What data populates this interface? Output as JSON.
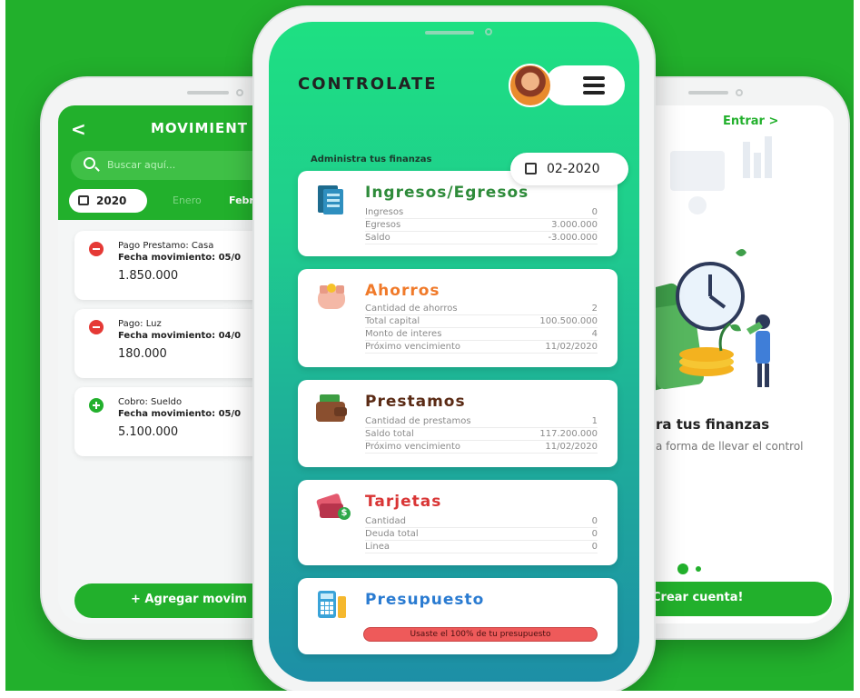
{
  "colors": {
    "brand_green": "#22b02c",
    "income_title": "#2e8b3a",
    "savings_title": "#f07a2a",
    "loans_title": "#5a2a14",
    "cards_title": "#d93535",
    "budget_title": "#2a7bd1"
  },
  "left_screen": {
    "title": "MOVIMIENT",
    "back_icon": "back-chevron-icon",
    "search_placeholder": "Buscar aquí...",
    "year": "2020",
    "months": [
      "Enero",
      "Febr"
    ],
    "movements": [
      {
        "title": "Pago Prestamo: Casa",
        "date": "Fecha movimiento: 05/0",
        "amount": "1.850.000",
        "type": "minus"
      },
      {
        "title": "Pago: Luz",
        "date": "Fecha movimiento: 04/0",
        "amount": "180.000",
        "type": "minus"
      },
      {
        "title": "Cobro: Sueldo",
        "date": "Fecha movimiento: 05/0",
        "amount": "5.100.000",
        "type": "plus"
      }
    ],
    "add_button": "+ Agregar movim"
  },
  "center_screen": {
    "brand": "CONTROLATE",
    "subtitle": "Administra tus finanzas",
    "date_filter": "02-2020",
    "cards": [
      {
        "title": "Ingresos/Egresos",
        "rows": [
          {
            "label": "Ingresos",
            "value": "0"
          },
          {
            "label": "Egresos",
            "value": "3.000.000"
          },
          {
            "label": "Saldo",
            "value": "-3.000.000"
          }
        ]
      },
      {
        "title": "Ahorros",
        "rows": [
          {
            "label": "Cantidad de ahorros",
            "value": "2"
          },
          {
            "label": "Total capital",
            "value": "100.500.000"
          },
          {
            "label": "Monto de interes",
            "value": "4"
          },
          {
            "label": "Próximo vencimiento",
            "value": "11/02/2020"
          }
        ]
      },
      {
        "title": "Prestamos",
        "rows": [
          {
            "label": "Cantidad de prestamos",
            "value": "1"
          },
          {
            "label": "Saldo total",
            "value": "117.200.000"
          },
          {
            "label": "Próximo vencimiento",
            "value": "11/02/2020"
          }
        ]
      },
      {
        "title": "Tarjetas",
        "rows": [
          {
            "label": "Cantidad",
            "value": "0"
          },
          {
            "label": "Deuda total",
            "value": "0"
          },
          {
            "label": "Linea",
            "value": "0"
          }
        ]
      },
      {
        "title": "Presupuesto",
        "alert": "Usaste el 100% de tu presupuesto"
      }
    ]
  },
  "right_screen": {
    "enter_link": "Entrar >",
    "headline": "ra tus finanzas",
    "body": "a forma de llevar el control",
    "create_button": "Crear cuenta!"
  }
}
